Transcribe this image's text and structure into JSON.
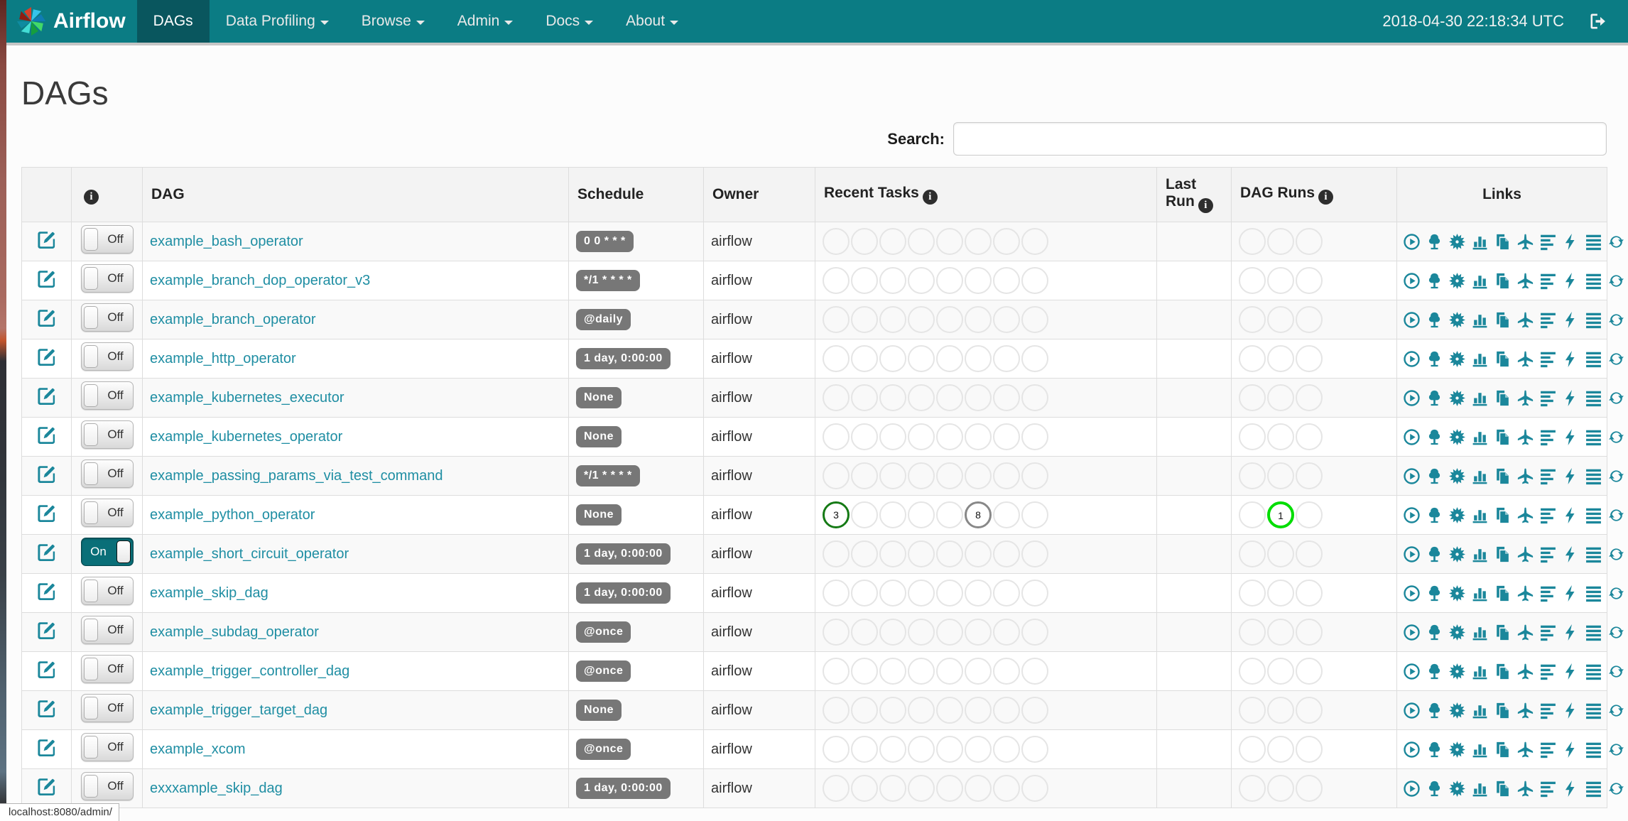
{
  "navbar": {
    "brand": "Airflow",
    "items": [
      {
        "label": "DAGs",
        "active": true,
        "dropdown": false
      },
      {
        "label": "Data Profiling",
        "active": false,
        "dropdown": true
      },
      {
        "label": "Browse",
        "active": false,
        "dropdown": true
      },
      {
        "label": "Admin",
        "active": false,
        "dropdown": true
      },
      {
        "label": "Docs",
        "active": false,
        "dropdown": true
      },
      {
        "label": "About",
        "active": false,
        "dropdown": true
      }
    ],
    "clock": "2018-04-30 22:18:34 UTC",
    "logout_icon": "logout-icon"
  },
  "page": {
    "title": "DAGs",
    "search_label": "Search:",
    "search_value": ""
  },
  "table": {
    "columns": [
      {
        "label": "",
        "info_icon": false,
        "align": "left"
      },
      {
        "label": "",
        "info_icon": true,
        "align": "left"
      },
      {
        "label": "DAG",
        "info_icon": false,
        "align": "left"
      },
      {
        "label": "Schedule",
        "info_icon": false,
        "align": "left"
      },
      {
        "label": "Owner",
        "info_icon": false,
        "align": "left"
      },
      {
        "label": "Recent Tasks",
        "info_icon": true,
        "align": "left"
      },
      {
        "label": "Last Run",
        "info_icon": true,
        "align": "left"
      },
      {
        "label": "DAG Runs",
        "info_icon": true,
        "align": "left"
      },
      {
        "label": "Links",
        "info_icon": false,
        "align": "center"
      }
    ],
    "recent_task_slots": 8,
    "dag_run_slots": 3,
    "toggle_on_label": "On",
    "toggle_off_label": "Off",
    "link_icons": [
      "trigger-dag",
      "tree-view",
      "graph-view",
      "tasks-duration",
      "task-tries",
      "landing-times",
      "gantt",
      "code-view",
      "logs",
      "refresh"
    ]
  },
  "colors": {
    "navbar_bg": "#0b7c84",
    "navbar_active_bg": "#09565e",
    "accent_teal": "#1b879b",
    "schedule_badge_bg": "#777777",
    "states": {
      "success": "#157a15",
      "running": "#00dd00",
      "none": "#888888"
    }
  },
  "dags": [
    {
      "name": "example_bash_operator",
      "schedule": "0 0 * * *",
      "owner": "airflow",
      "paused": true,
      "recent_tasks": [],
      "dag_runs": []
    },
    {
      "name": "example_branch_dop_operator_v3",
      "schedule": "*/1 * * * *",
      "owner": "airflow",
      "paused": true,
      "recent_tasks": [],
      "dag_runs": []
    },
    {
      "name": "example_branch_operator",
      "schedule": "@daily",
      "owner": "airflow",
      "paused": true,
      "recent_tasks": [],
      "dag_runs": []
    },
    {
      "name": "example_http_operator",
      "schedule": "1 day, 0:00:00",
      "owner": "airflow",
      "paused": true,
      "recent_tasks": [],
      "dag_runs": []
    },
    {
      "name": "example_kubernetes_executor",
      "schedule": "None",
      "owner": "airflow",
      "paused": true,
      "recent_tasks": [],
      "dag_runs": []
    },
    {
      "name": "example_kubernetes_operator",
      "schedule": "None",
      "owner": "airflow",
      "paused": true,
      "recent_tasks": [],
      "dag_runs": []
    },
    {
      "name": "example_passing_params_via_test_command",
      "schedule": "*/1 * * * *",
      "owner": "airflow",
      "paused": true,
      "recent_tasks": [],
      "dag_runs": []
    },
    {
      "name": "example_python_operator",
      "schedule": "None",
      "owner": "airflow",
      "paused": true,
      "recent_tasks": [
        {
          "slot": 1,
          "count": "3",
          "state": "success"
        },
        {
          "slot": 6,
          "count": "8",
          "state": "none"
        }
      ],
      "dag_runs": [
        {
          "slot": 2,
          "count": "1",
          "state": "running"
        }
      ]
    },
    {
      "name": "example_short_circuit_operator",
      "schedule": "1 day, 0:00:00",
      "owner": "airflow",
      "paused": false,
      "recent_tasks": [],
      "dag_runs": []
    },
    {
      "name": "example_skip_dag",
      "schedule": "1 day, 0:00:00",
      "owner": "airflow",
      "paused": true,
      "recent_tasks": [],
      "dag_runs": []
    },
    {
      "name": "example_subdag_operator",
      "schedule": "@once",
      "owner": "airflow",
      "paused": true,
      "recent_tasks": [],
      "dag_runs": []
    },
    {
      "name": "example_trigger_controller_dag",
      "schedule": "@once",
      "owner": "airflow",
      "paused": true,
      "recent_tasks": [],
      "dag_runs": []
    },
    {
      "name": "example_trigger_target_dag",
      "schedule": "None",
      "owner": "airflow",
      "paused": true,
      "recent_tasks": [],
      "dag_runs": []
    },
    {
      "name": "example_xcom",
      "schedule": "@once",
      "owner": "airflow",
      "paused": true,
      "recent_tasks": [],
      "dag_runs": []
    },
    {
      "name": "exxxample_skip_dag",
      "schedule": "1 day, 0:00:00",
      "owner": "airflow",
      "paused": true,
      "recent_tasks": [],
      "dag_runs": []
    }
  ],
  "statusbar": {
    "text": "localhost:8080/admin/"
  }
}
